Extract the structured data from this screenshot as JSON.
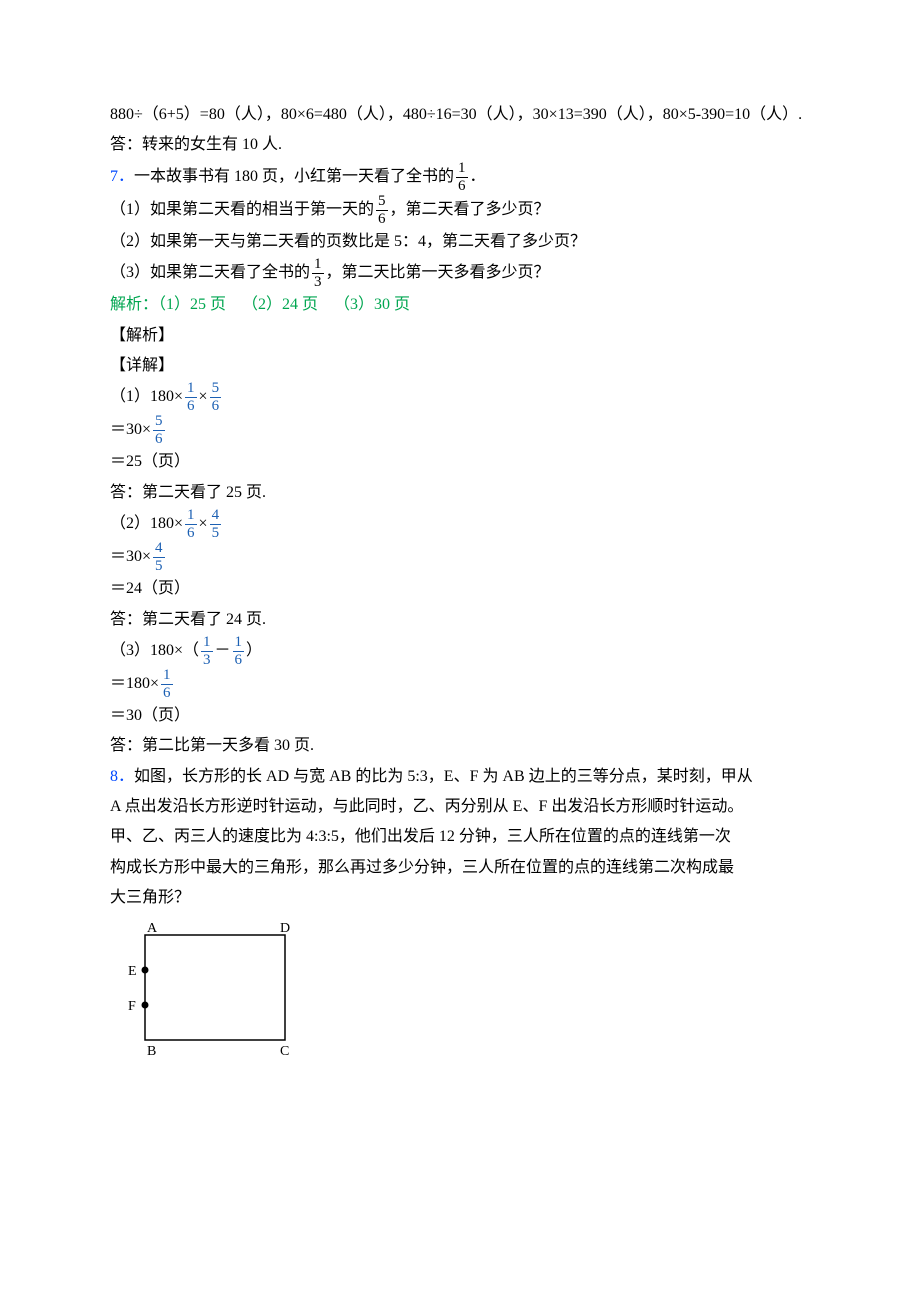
{
  "l1": "880÷（6+5）=80（人），80×6=480（人），480÷16=30（人），30×13=390（人），80×5-390=10（人）.",
  "l2": "答：转来的女生有 10 人.",
  "q7_num": "7．",
  "q7_a": "一本故事书有 180 页，小红第一天看了全书的",
  "q7_b": "．",
  "q7_1a": "（1）如果第二天看的相当于第一天的",
  "q7_1b": "，第二天看了多少页？",
  "q7_2": "（2）如果第一天与第二天看的页数比是 5：4，第二天看了多少页？",
  "q7_3a": "（3）如果第二天看了全书的",
  "q7_3b": "，第二天比第一天多看多少页？",
  "ans7": "解析：（1）25 页 （2）24 页 （3）30 页",
  "jiexi": "【解析】",
  "xiangjie": "【详解】",
  "s1a": "（1）180×",
  "s1b": "×",
  "s1c": "＝30×",
  "s1d": "＝25（页）",
  "s1e": "答：第二天看了 25 页.",
  "s2a": "（2）180×",
  "s2b": "×",
  "s2c": "＝30×",
  "s2d": "＝24（页）",
  "s2e": "答：第二天看了 24 页.",
  "s3a": "（3）180×（",
  "s3b": "－",
  "s3c": "）",
  "s3d": "＝180×",
  "s3e": "＝30（页）",
  "s3f": "答：第二比第一天多看 30 页.",
  "q8_num": "8．",
  "q8_1": "如图，长方形的长 AD 与宽 AB 的比为 5:3，E、F 为 AB 边上的三等分点，某时刻，甲从",
  "q8_2": "A 点出发沿长方形逆时针运动，与此同时，乙、丙分别从 E、F 出发沿长方形顺时针运动。",
  "q8_3": "甲、乙、丙三人的速度比为 4:3:5，他们出发后 12 分钟，三人所在位置的点的连线第一次",
  "q8_4": "构成长方形中最大的三角形，那么再过多少分钟，三人所在位置的点的连线第二次构成最",
  "q8_5": "大三角形？",
  "labels": {
    "A": "A",
    "D": "D",
    "E": "E",
    "F": "F",
    "B": "B",
    "C": "C"
  },
  "fracs": {
    "one_sixth": {
      "n": "1",
      "d": "6"
    },
    "five_sixth": {
      "n": "5",
      "d": "6"
    },
    "one_third": {
      "n": "1",
      "d": "3"
    },
    "four_fifth": {
      "n": "4",
      "d": "5"
    }
  }
}
